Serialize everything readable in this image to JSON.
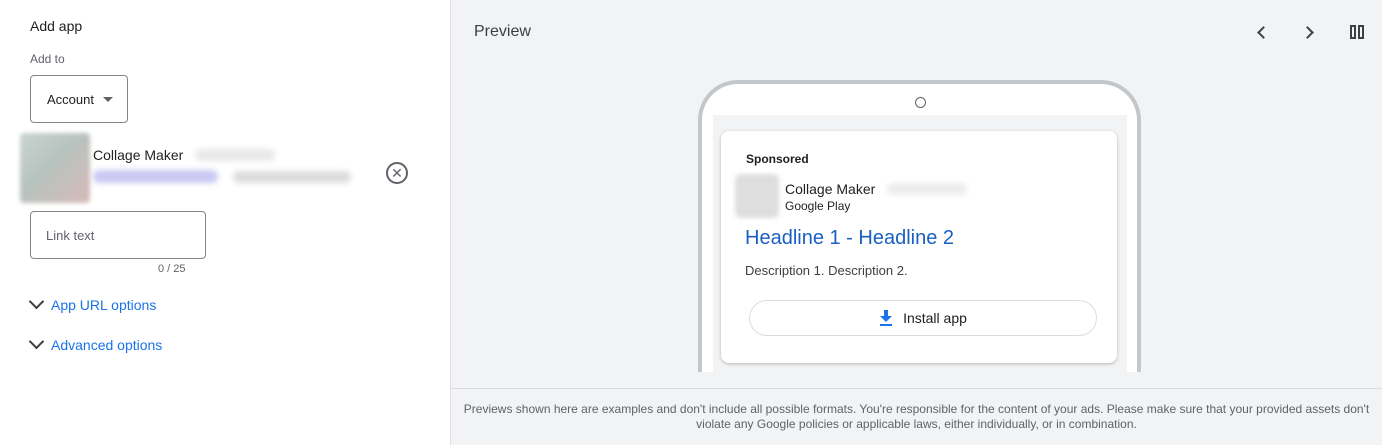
{
  "left_panel": {
    "title": "Add app",
    "add_to_label": "Add to",
    "add_to_value": "Account",
    "selected_app": {
      "name": "Collage Maker",
      "remove_icon": "close-circle-icon"
    },
    "link_text": {
      "placeholder": "Link text",
      "value": "",
      "char_count": "0 / 25"
    },
    "expanders": [
      {
        "label": "App URL options",
        "icon": "chevron-down-icon"
      },
      {
        "label": "Advanced options",
        "icon": "chevron-down-icon"
      }
    ]
  },
  "preview": {
    "title": "Preview",
    "nav_icons": [
      "chevron-left-icon",
      "chevron-right-icon",
      "columns-icon"
    ],
    "ad": {
      "sponsored_label": "Sponsored",
      "app_name": "Collage Maker",
      "store": "Google Play",
      "headline": "Headline 1 - Headline 2",
      "description": "Description 1. Description 2.",
      "install_label": "Install app",
      "install_icon": "download-icon"
    },
    "footer_note": "Previews shown here are examples and don't include all possible formats. You're responsible for the content of your ads. Please make sure that your provided assets don't violate any Google policies or applicable laws, either individually, or in combination."
  },
  "colors": {
    "link_blue": "#1a73e8",
    "headline_blue": "#1a5fc2",
    "preview_bg": "#f1f3f4",
    "border_gray": "#80868b"
  }
}
